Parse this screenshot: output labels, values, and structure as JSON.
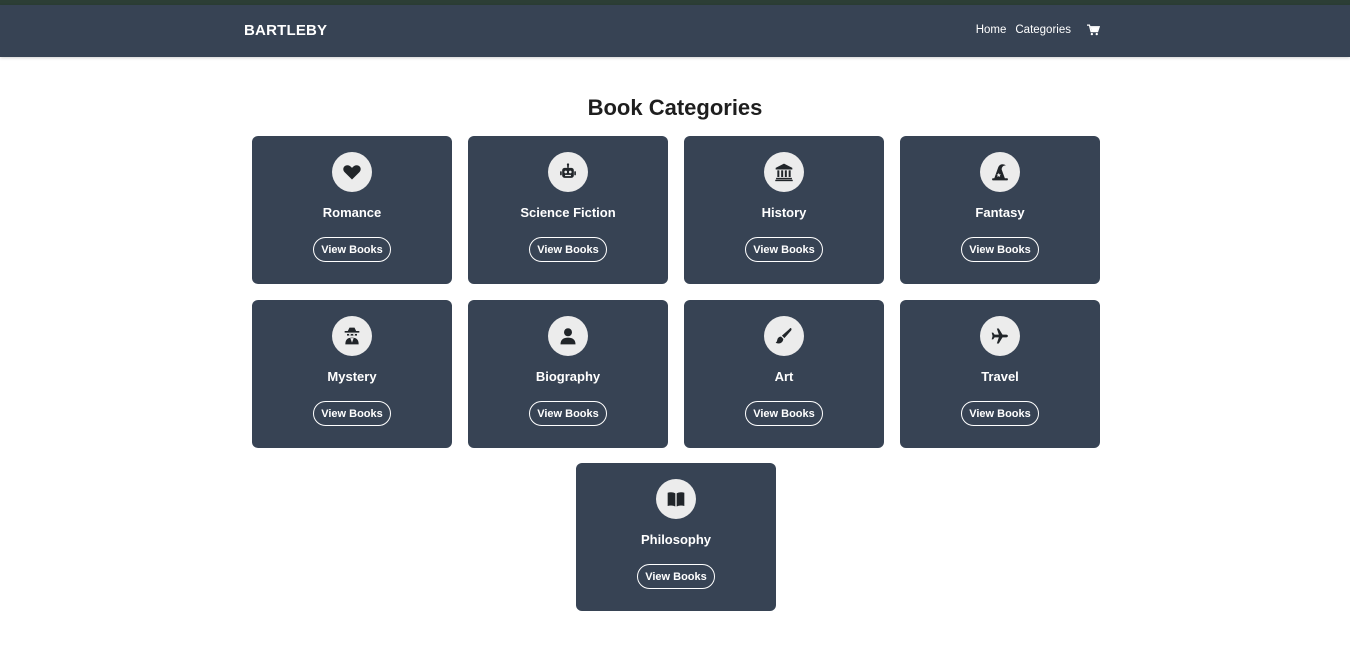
{
  "navbar": {
    "brand": "BARTLEBY",
    "links": [
      "Home",
      "Categories"
    ],
    "cart_icon": "cart-icon"
  },
  "page": {
    "title": "Book Categories"
  },
  "categories": [
    {
      "name": "Romance",
      "icon": "heart-icon",
      "button": "View Books"
    },
    {
      "name": "Science Fiction",
      "icon": "robot-icon",
      "button": "View Books"
    },
    {
      "name": "History",
      "icon": "landmark-icon",
      "button": "View Books"
    },
    {
      "name": "Fantasy",
      "icon": "wizard-hat-icon",
      "button": "View Books"
    },
    {
      "name": "Mystery",
      "icon": "detective-icon",
      "button": "View Books"
    },
    {
      "name": "Biography",
      "icon": "user-icon",
      "button": "View Books"
    },
    {
      "name": "Art",
      "icon": "paintbrush-icon",
      "button": "View Books"
    },
    {
      "name": "Travel",
      "icon": "plane-icon",
      "button": "View Books"
    },
    {
      "name": "Philosophy",
      "icon": "book-open-icon",
      "button": "View Books"
    }
  ],
  "colors": {
    "navbar": "#374354",
    "card": "#374354",
    "icon_bg": "#ececec",
    "icon_fg": "#212529"
  }
}
